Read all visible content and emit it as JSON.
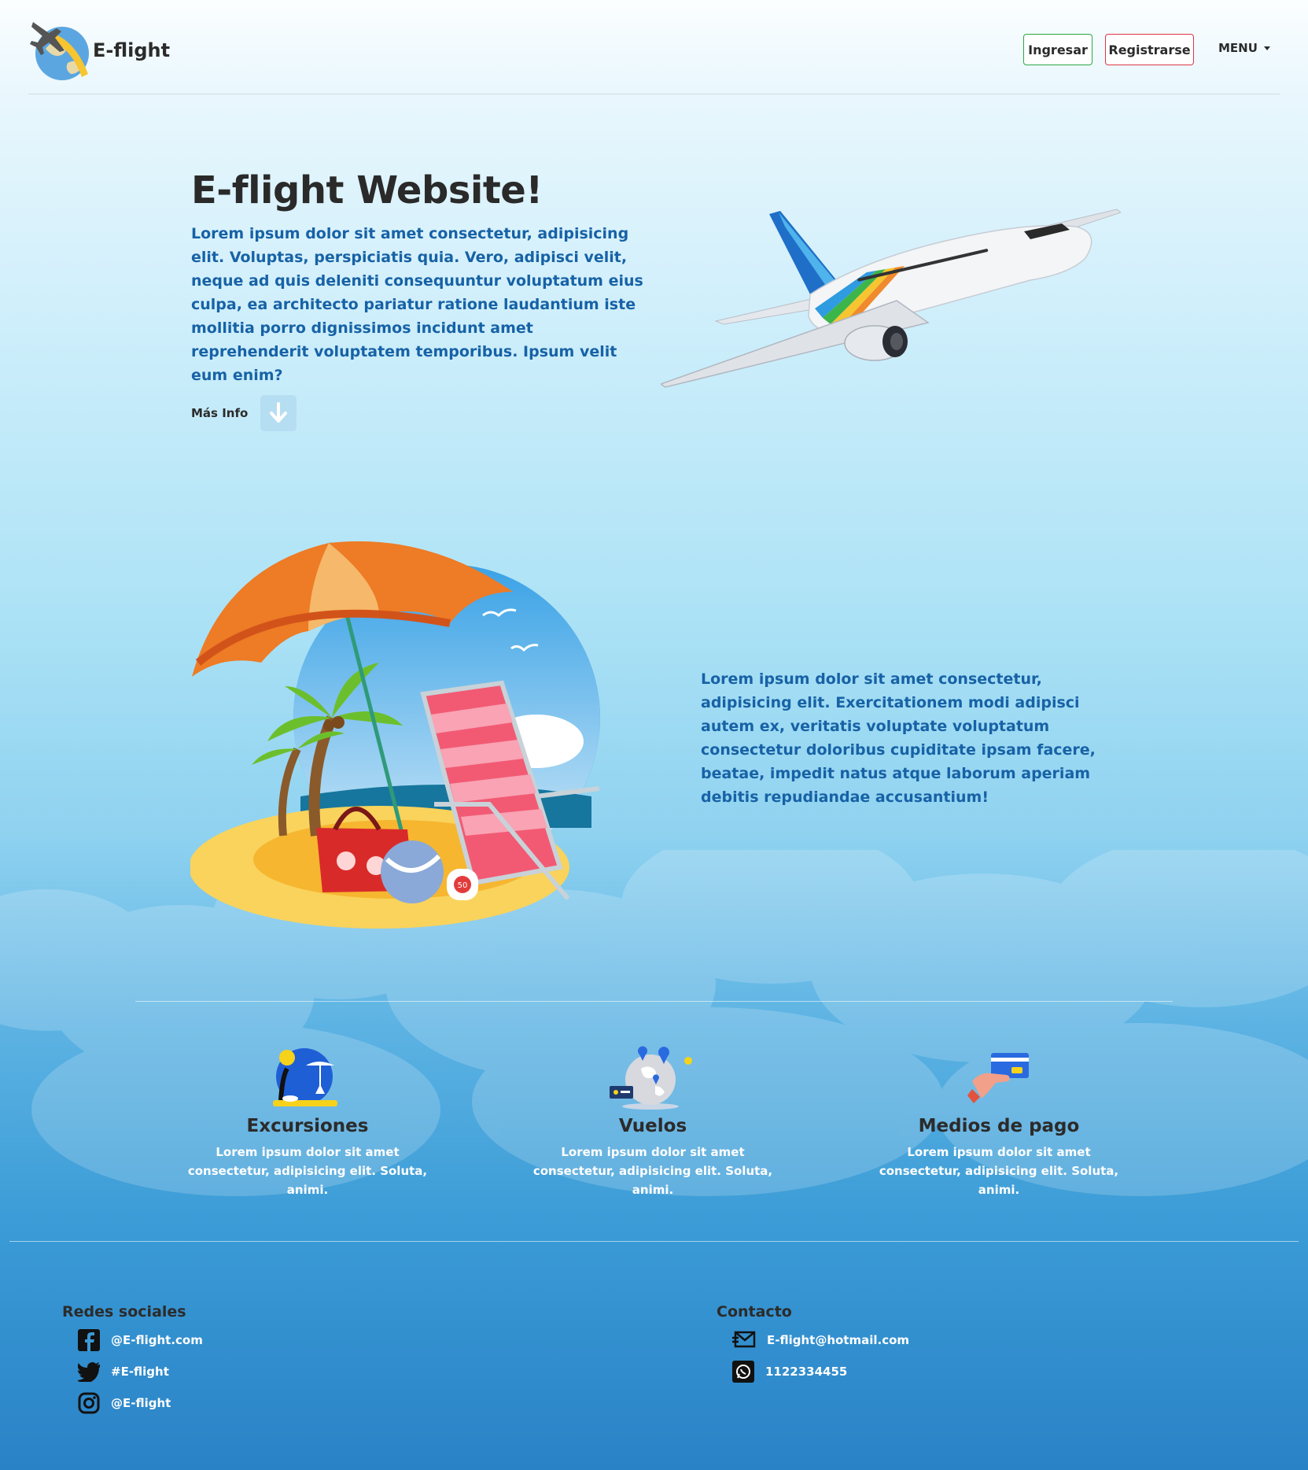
{
  "colors": {
    "accent_text": "#1762a6",
    "login_border": "#28a745",
    "register_border": "#dc3545"
  },
  "navbar": {
    "brand": "E-flight",
    "login_label": "Ingresar",
    "register_label": "Registrarse",
    "menu_label": "MENU"
  },
  "hero": {
    "title": "E-flight Website!",
    "text": "Lorem ipsum dolor sit amet consectetur, adipisicing elit. Voluptas, perspiciatis quia. Vero, adipisci velit, neque ad quis deleniti consequuntur voluptatum eius culpa, ea architecto pariatur ratione laudantium iste mollitia porro dignissimos incidunt amet reprehenderit voluptatem temporibus. Ipsum velit eum enim?",
    "more_info_label": "Más Info",
    "more_info_icon": "arrow-down-icon"
  },
  "section2": {
    "text": "Lorem ipsum dolor sit amet consectetur, adipisicing elit. Exercitationem modi adipisci autem ex, veritatis voluptate voluptatum consectetur doloribus cupiditate ipsam facere, beatae, impedit natus atque laborum aperiam debitis repudiandae accusantium!"
  },
  "features": [
    {
      "title": "Excursiones",
      "text": "Lorem ipsum dolor sit amet consectetur, adipisicing elit. Soluta, animi.",
      "icon": "beach-icon"
    },
    {
      "title": "Vuelos",
      "text": "Lorem ipsum dolor sit amet consectetur, adipisicing elit. Soluta, animi.",
      "icon": "globe-map-icon"
    },
    {
      "title": "Medios de pago",
      "text": "Lorem ipsum dolor sit amet consectetur, adipisicing elit. Soluta, animi.",
      "icon": "credit-card-icon"
    }
  ],
  "footer": {
    "social_title": "Redes sociales",
    "social": [
      {
        "icon": "facebook-icon",
        "label": "@E-flight.com"
      },
      {
        "icon": "twitter-icon",
        "label": "#E-flight"
      },
      {
        "icon": "instagram-icon",
        "label": "@E-flight"
      }
    ],
    "contact_title": "Contacto",
    "contact": [
      {
        "icon": "mail-icon",
        "label": "E-flight@hotmail.com"
      },
      {
        "icon": "whatsapp-icon",
        "label": "1122334455"
      }
    ]
  }
}
